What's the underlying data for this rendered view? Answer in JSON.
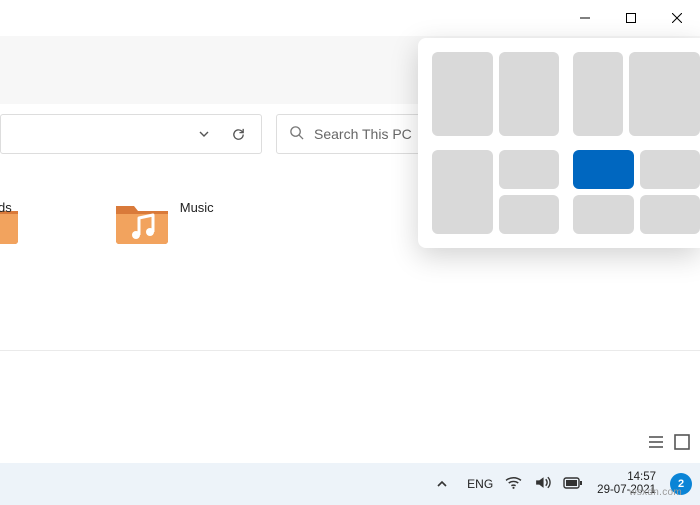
{
  "window_controls": {
    "minimize": "minimize",
    "maximize": "maximize",
    "close": "close"
  },
  "nav": {
    "history_icon": "chevron-down",
    "refresh_icon": "refresh"
  },
  "search": {
    "placeholder": "Search This PC"
  },
  "folders": [
    {
      "label_fragment": "ds",
      "name": "downloads-folder"
    },
    {
      "label": "Music",
      "name": "music-folder"
    }
  ],
  "snap_layouts": {
    "options": [
      {
        "id": "split-5050",
        "cols": 2
      },
      {
        "id": "split-4060",
        "cols": 2
      },
      {
        "id": "split-50-25-25",
        "cols": 3
      },
      {
        "id": "quadrant",
        "cols": 4,
        "selected_cell": 0
      }
    ]
  },
  "view_buttons": {
    "list": "list-view",
    "tiles": "tiles-view"
  },
  "taskbar": {
    "lang": "ENG",
    "time": "14:57",
    "date": "29-07-2021",
    "notif_count": "2",
    "watermark": "wsxdn.com"
  }
}
